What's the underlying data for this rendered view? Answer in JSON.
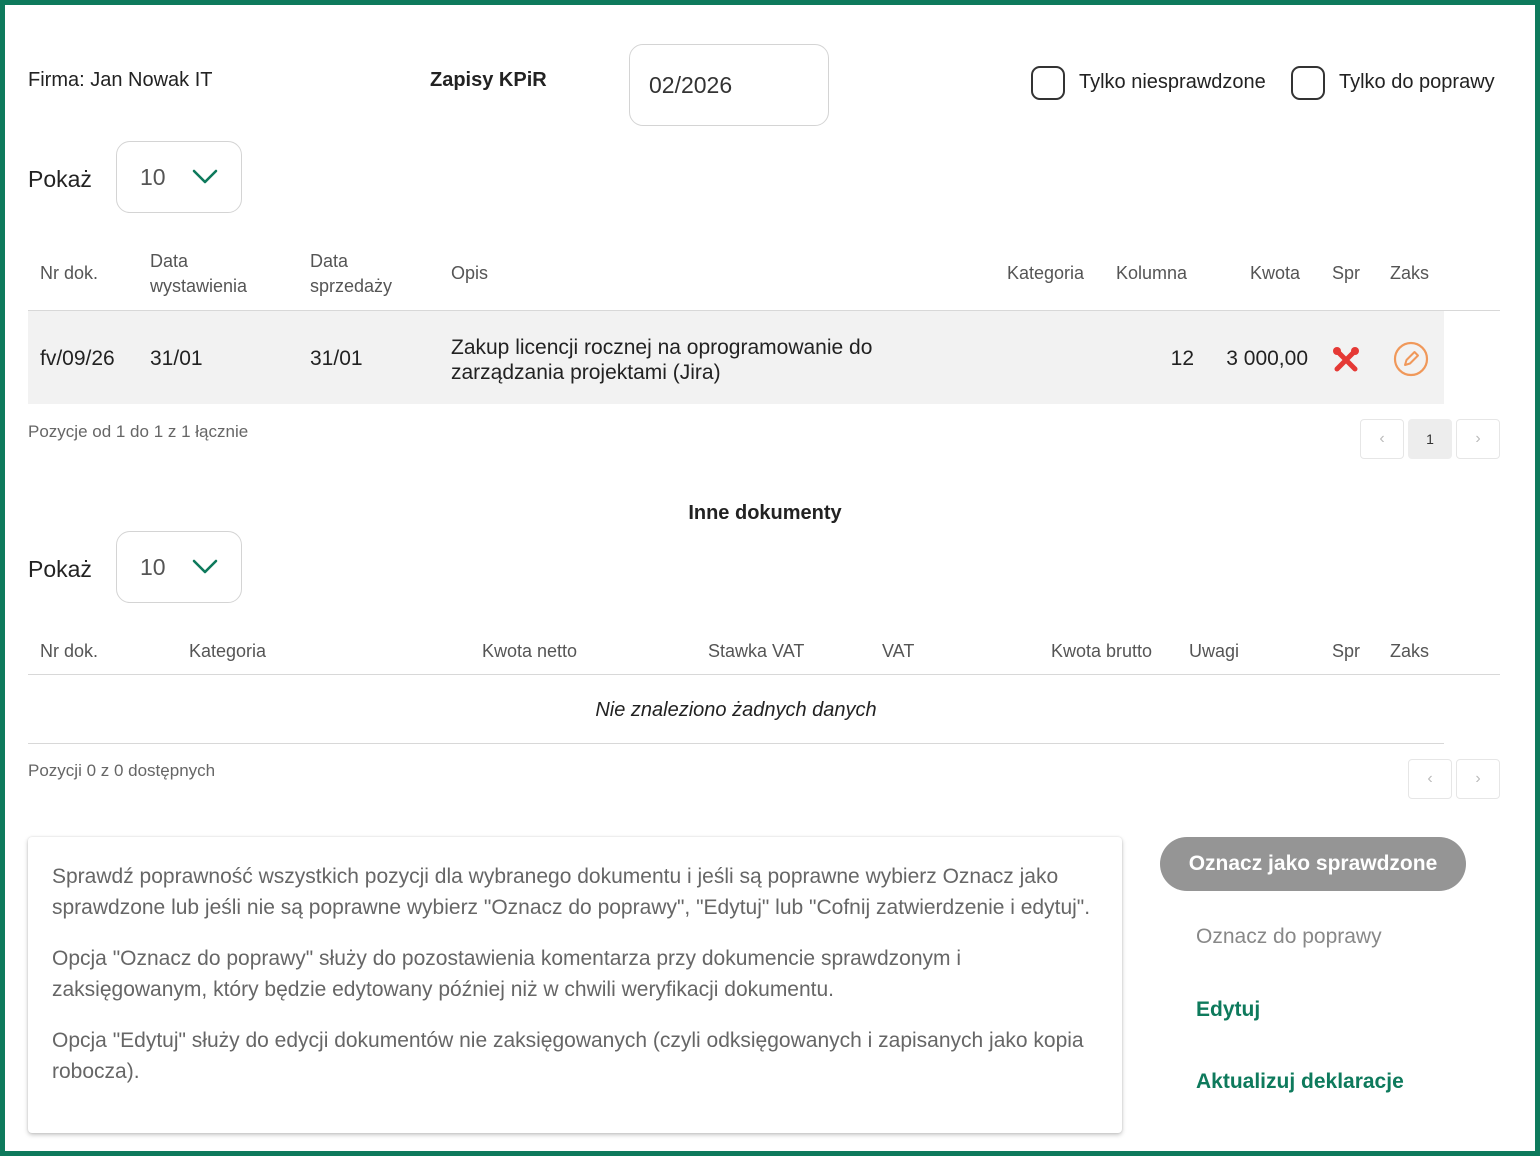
{
  "header": {
    "company": "Firma: Jan Nowak IT",
    "title": "Zapisy KPiR",
    "period_value": "02/2026",
    "filter_unchecked_label": "Tylko niesprawdzone",
    "filter_correction_label": "Tylko do poprawy"
  },
  "kpir": {
    "show_label": "Pokaż",
    "page_size": "10",
    "columns": {
      "nr": "Nr dok.",
      "issue_date_1": "Data",
      "issue_date_2": "wystawienia",
      "sale_date_1": "Data",
      "sale_date_2": "sprzedaży",
      "desc": "Opis",
      "category": "Kategoria",
      "column": "Kolumna",
      "amount": "Kwota",
      "checked": "Spr",
      "booked": "Zaks"
    },
    "rows": [
      {
        "nr": "fv/09/26",
        "issue_date": "31/01",
        "sale_date": "31/01",
        "desc_line1": "Zakup licencji rocznej na oprogramowanie do",
        "desc_line2": "zarządzania projektami (Jira)",
        "category": "",
        "column": "12",
        "amount": "3 000,00",
        "checked_icon": "tools-icon",
        "booked_icon": "pencil-circle-icon"
      }
    ],
    "info": "Pozycje od 1 do 1 z 1 łącznie",
    "pagination": {
      "prev": "‹",
      "current": "1",
      "next": "›"
    }
  },
  "other_docs": {
    "title": "Inne dokumenty",
    "show_label": "Pokaż",
    "page_size": "10",
    "columns": {
      "nr": "Nr dok.",
      "category": "Kategoria",
      "net": "Kwota netto",
      "vat_rate": "Stawka VAT",
      "vat": "VAT",
      "gross": "Kwota brutto",
      "notes": "Uwagi",
      "checked": "Spr",
      "booked": "Zaks"
    },
    "empty": "Nie znaleziono żadnych danych",
    "info": "Pozycji 0 z 0 dostępnych",
    "pagination": {
      "prev": "‹",
      "next": "›"
    }
  },
  "help": {
    "p1": "Sprawdź poprawność wszystkich pozycji dla wybranego dokumentu i jeśli są poprawne wybierz Oznacz jako sprawdzone lub jeśli nie są poprawne wybierz \"Oznacz do poprawy\", \"Edytuj\" lub \"Cofnij zatwierdzenie i edytuj\".",
    "p2": "Opcja \"Oznacz do poprawy\" służy do pozostawienia komentarza przy dokumencie sprawdzonym i zaksięgowanym, który będzie edytowany później niż w chwili weryfikacji dokumentu.",
    "p3": "Opcja \"Edytuj\" służy do edycji dokumentów nie zaksięgowanych (czyli odksięgowanych i zapisanych jako kopia robocza)."
  },
  "actions": {
    "mark_checked": "Oznacz jako sprawdzone",
    "mark_correction": "Oznacz do poprawy",
    "edit": "Edytuj",
    "update_declarations": "Aktualizuj deklaracje"
  },
  "colors": {
    "frame": "#0e7a5c",
    "accent_green": "#0e7a5c",
    "error_red": "#e53935",
    "edit_orange": "#f0985a",
    "button_gray": "#959595"
  }
}
